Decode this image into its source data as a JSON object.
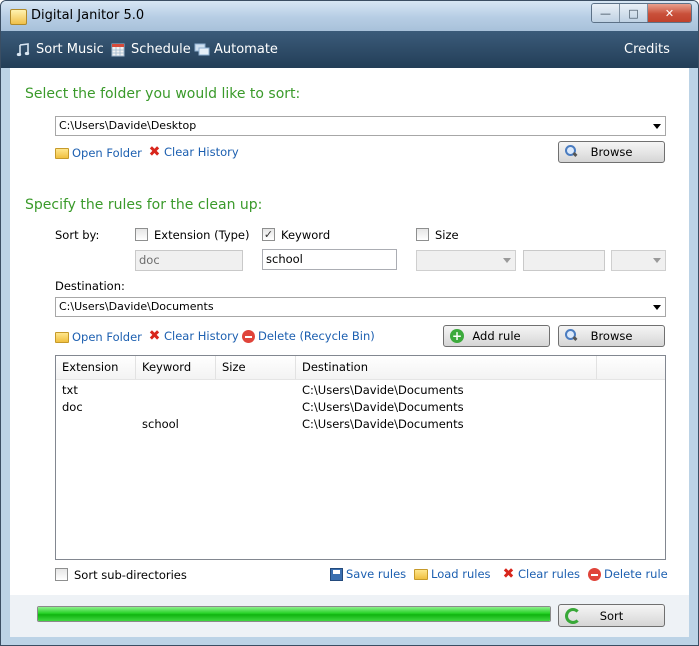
{
  "window": {
    "title": "Digital Janitor 5.0"
  },
  "nav": {
    "sort_music": "Sort Music",
    "schedule": "Schedule",
    "automate": "Automate",
    "credits": "Credits"
  },
  "source": {
    "heading": "Select the folder you would like to sort:",
    "path": "C:\\Users\\Davide\\Desktop",
    "open_folder": "Open Folder",
    "clear_history": "Clear History",
    "browse": "Browse"
  },
  "rules": {
    "heading": "Specify the rules for the clean up:",
    "sort_by_label": "Sort by:",
    "extension": {
      "label": "Extension (Type)",
      "checked": false,
      "value": "doc"
    },
    "keyword": {
      "label": "Keyword",
      "checked": true,
      "value": "school"
    },
    "size": {
      "label": "Size",
      "checked": false
    },
    "destination_label": "Destination:",
    "destination_path": "C:\\Users\\Davide\\Documents",
    "open_folder": "Open Folder",
    "clear_history": "Clear History",
    "delete": "Delete (Recycle Bin)",
    "add_rule": "Add rule",
    "browse": "Browse"
  },
  "table": {
    "columns": [
      "Extension",
      "Keyword",
      "Size",
      "Destination"
    ],
    "rows": [
      {
        "extension": "txt",
        "keyword": "",
        "size": "",
        "destination": "C:\\Users\\Davide\\Documents"
      },
      {
        "extension": "doc",
        "keyword": "",
        "size": "",
        "destination": "C:\\Users\\Davide\\Documents"
      },
      {
        "extension": "",
        "keyword": "school",
        "size": "",
        "destination": "C:\\Users\\Davide\\Documents"
      }
    ]
  },
  "footer": {
    "sort_subdirs": "Sort sub-directories",
    "save_rules": "Save rules",
    "load_rules": "Load rules",
    "clear_rules": "Clear rules",
    "delete_rule": "Delete rule"
  },
  "bottom": {
    "progress": 1.0,
    "sort": "Sort"
  },
  "colors": {
    "accent_green": "#3a9a2a",
    "link_blue": "#1c5fb0",
    "nav_bg": "#2c4966",
    "progress_green": "#22cc22"
  }
}
